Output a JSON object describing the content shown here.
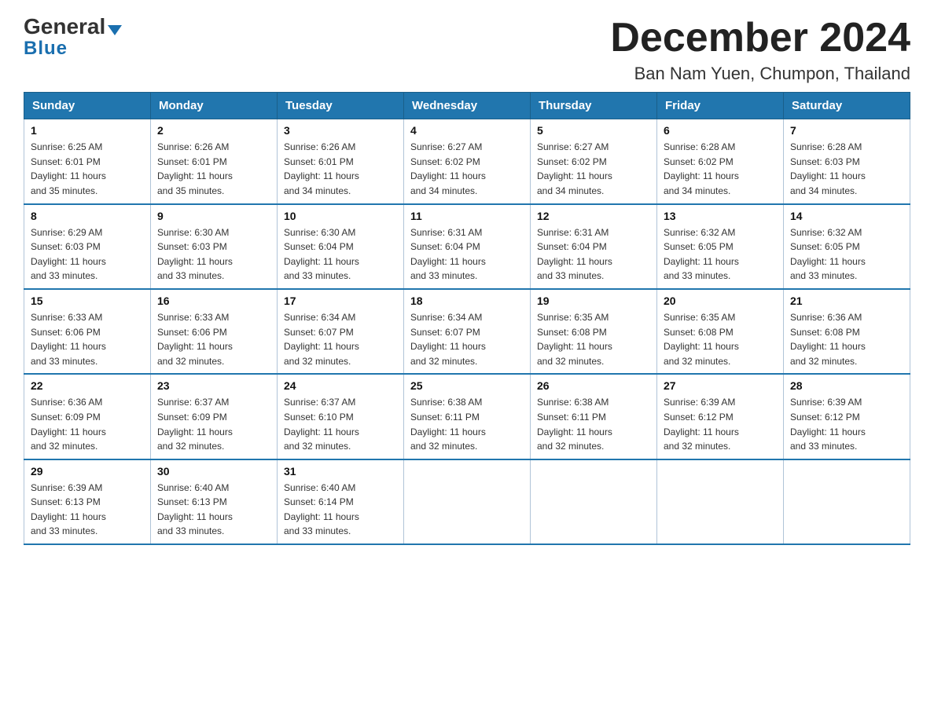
{
  "header": {
    "logo_line1": "General",
    "logo_line2": "Blue",
    "month_title": "December 2024",
    "location": "Ban Nam Yuen, Chumpon, Thailand"
  },
  "days_of_week": [
    "Sunday",
    "Monday",
    "Tuesday",
    "Wednesday",
    "Thursday",
    "Friday",
    "Saturday"
  ],
  "weeks": [
    [
      {
        "day": "1",
        "sunrise": "6:25 AM",
        "sunset": "6:01 PM",
        "daylight": "11 hours and 35 minutes."
      },
      {
        "day": "2",
        "sunrise": "6:26 AM",
        "sunset": "6:01 PM",
        "daylight": "11 hours and 35 minutes."
      },
      {
        "day": "3",
        "sunrise": "6:26 AM",
        "sunset": "6:01 PM",
        "daylight": "11 hours and 34 minutes."
      },
      {
        "day": "4",
        "sunrise": "6:27 AM",
        "sunset": "6:02 PM",
        "daylight": "11 hours and 34 minutes."
      },
      {
        "day": "5",
        "sunrise": "6:27 AM",
        "sunset": "6:02 PM",
        "daylight": "11 hours and 34 minutes."
      },
      {
        "day": "6",
        "sunrise": "6:28 AM",
        "sunset": "6:02 PM",
        "daylight": "11 hours and 34 minutes."
      },
      {
        "day": "7",
        "sunrise": "6:28 AM",
        "sunset": "6:03 PM",
        "daylight": "11 hours and 34 minutes."
      }
    ],
    [
      {
        "day": "8",
        "sunrise": "6:29 AM",
        "sunset": "6:03 PM",
        "daylight": "11 hours and 33 minutes."
      },
      {
        "day": "9",
        "sunrise": "6:30 AM",
        "sunset": "6:03 PM",
        "daylight": "11 hours and 33 minutes."
      },
      {
        "day": "10",
        "sunrise": "6:30 AM",
        "sunset": "6:04 PM",
        "daylight": "11 hours and 33 minutes."
      },
      {
        "day": "11",
        "sunrise": "6:31 AM",
        "sunset": "6:04 PM",
        "daylight": "11 hours and 33 minutes."
      },
      {
        "day": "12",
        "sunrise": "6:31 AM",
        "sunset": "6:04 PM",
        "daylight": "11 hours and 33 minutes."
      },
      {
        "day": "13",
        "sunrise": "6:32 AM",
        "sunset": "6:05 PM",
        "daylight": "11 hours and 33 minutes."
      },
      {
        "day": "14",
        "sunrise": "6:32 AM",
        "sunset": "6:05 PM",
        "daylight": "11 hours and 33 minutes."
      }
    ],
    [
      {
        "day": "15",
        "sunrise": "6:33 AM",
        "sunset": "6:06 PM",
        "daylight": "11 hours and 33 minutes."
      },
      {
        "day": "16",
        "sunrise": "6:33 AM",
        "sunset": "6:06 PM",
        "daylight": "11 hours and 32 minutes."
      },
      {
        "day": "17",
        "sunrise": "6:34 AM",
        "sunset": "6:07 PM",
        "daylight": "11 hours and 32 minutes."
      },
      {
        "day": "18",
        "sunrise": "6:34 AM",
        "sunset": "6:07 PM",
        "daylight": "11 hours and 32 minutes."
      },
      {
        "day": "19",
        "sunrise": "6:35 AM",
        "sunset": "6:08 PM",
        "daylight": "11 hours and 32 minutes."
      },
      {
        "day": "20",
        "sunrise": "6:35 AM",
        "sunset": "6:08 PM",
        "daylight": "11 hours and 32 minutes."
      },
      {
        "day": "21",
        "sunrise": "6:36 AM",
        "sunset": "6:08 PM",
        "daylight": "11 hours and 32 minutes."
      }
    ],
    [
      {
        "day": "22",
        "sunrise": "6:36 AM",
        "sunset": "6:09 PM",
        "daylight": "11 hours and 32 minutes."
      },
      {
        "day": "23",
        "sunrise": "6:37 AM",
        "sunset": "6:09 PM",
        "daylight": "11 hours and 32 minutes."
      },
      {
        "day": "24",
        "sunrise": "6:37 AM",
        "sunset": "6:10 PM",
        "daylight": "11 hours and 32 minutes."
      },
      {
        "day": "25",
        "sunrise": "6:38 AM",
        "sunset": "6:11 PM",
        "daylight": "11 hours and 32 minutes."
      },
      {
        "day": "26",
        "sunrise": "6:38 AM",
        "sunset": "6:11 PM",
        "daylight": "11 hours and 32 minutes."
      },
      {
        "day": "27",
        "sunrise": "6:39 AM",
        "sunset": "6:12 PM",
        "daylight": "11 hours and 32 minutes."
      },
      {
        "day": "28",
        "sunrise": "6:39 AM",
        "sunset": "6:12 PM",
        "daylight": "11 hours and 33 minutes."
      }
    ],
    [
      {
        "day": "29",
        "sunrise": "6:39 AM",
        "sunset": "6:13 PM",
        "daylight": "11 hours and 33 minutes."
      },
      {
        "day": "30",
        "sunrise": "6:40 AM",
        "sunset": "6:13 PM",
        "daylight": "11 hours and 33 minutes."
      },
      {
        "day": "31",
        "sunrise": "6:40 AM",
        "sunset": "6:14 PM",
        "daylight": "11 hours and 33 minutes."
      },
      null,
      null,
      null,
      null
    ]
  ],
  "labels": {
    "sunrise": "Sunrise:",
    "sunset": "Sunset:",
    "daylight": "Daylight:"
  }
}
